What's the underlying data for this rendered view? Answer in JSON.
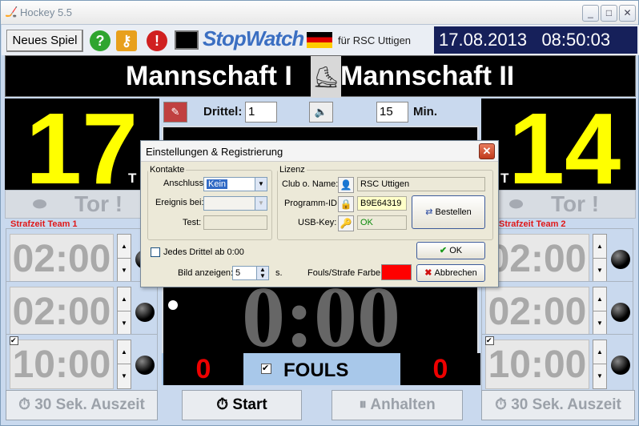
{
  "window": {
    "title": "Hockey 5.5"
  },
  "toolbar": {
    "new_game": "Neues Spiel",
    "brand": "StopWatch",
    "club_for": "für RSC Uttigen",
    "datetime": "17.08.2013   08:50:03"
  },
  "teams": {
    "home": "Mannschaft I",
    "away": "Mannschaft II"
  },
  "score": {
    "home": "17",
    "away": "14",
    "t_label": "T"
  },
  "goal_button": "Tor !",
  "penalty": {
    "header_home": "Strafzeit Team 1",
    "header_away": "Strafzeit Team 2",
    "home": [
      "02:00",
      "02:00",
      "10:00"
    ],
    "away": [
      "02:00",
      "02:00",
      "10:00"
    ]
  },
  "period": {
    "label": "Drittel:",
    "value": "1",
    "minutes": "15",
    "min_label": "Min."
  },
  "main_clock": "0:00",
  "fouls": {
    "label": "FOULS",
    "home": "0",
    "away": "0",
    "checked": "✔"
  },
  "bottom": {
    "timeout_home": "30 Sek. Auszeit",
    "start": "Start",
    "stop": "Anhalten",
    "timeout_away": "30 Sek. Auszeit"
  },
  "dialog": {
    "title": "Einstellungen & Registrierung",
    "kontakte": "Kontakte",
    "anschluss_label": "Anschluss:",
    "anschluss_value": "Kein",
    "ereignis_label": "Ereignis bei:",
    "test_label": "Test:",
    "lizenz": "Lizenz",
    "club_label": "Club o. Name:",
    "club_value": "RSC Uttigen",
    "prog_label": "Programm-ID:",
    "prog_value": "B9E64319",
    "usb_label": "USB-Key:",
    "usb_value": "OK",
    "bestellen": "Bestellen",
    "jedes": "Jedes Drittel ab 0:00",
    "bild_label": "Bild anzeigen:",
    "bild_value": "5",
    "bild_unit": "s.",
    "fouls_label": "Fouls/Strafe Farbe:",
    "fouls_color": "#ff0000",
    "ok": "OK",
    "abbrechen": "Abbrechen"
  }
}
